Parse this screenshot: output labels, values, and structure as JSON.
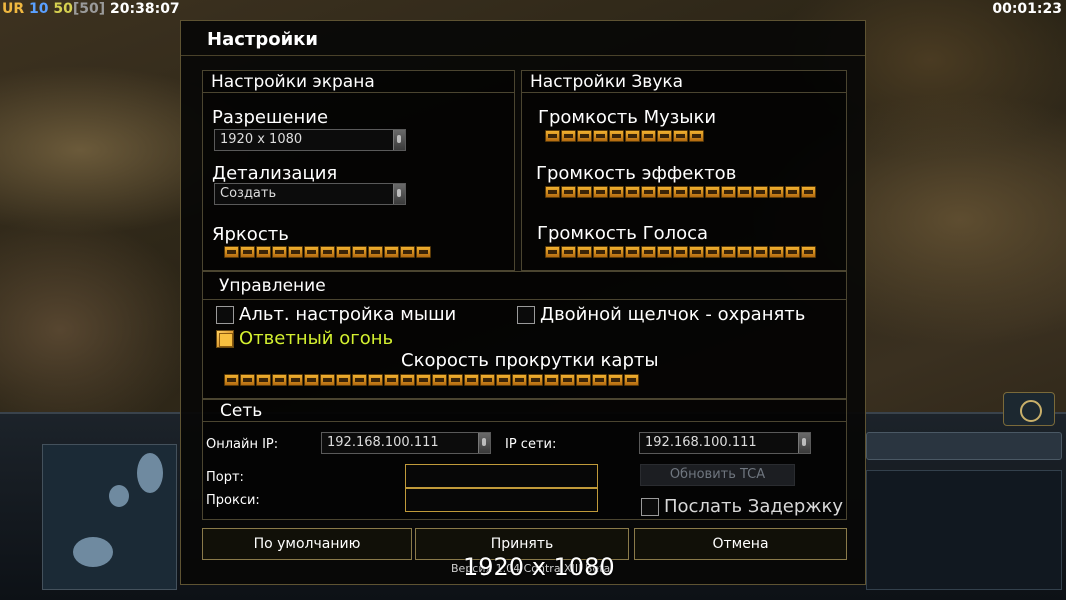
{
  "hud": {
    "ur": "UR",
    "n10": "10",
    "n50": "50",
    "bracket_value": "[50]",
    "clock": "20:38:07",
    "elapsed": "00:01:23"
  },
  "dialog": {
    "title": "Настройки",
    "screen": {
      "header": "Настройки экрана",
      "resolution_label": "Разрешение",
      "resolution_value": "1920 x 1080",
      "detail_label": "Детализация",
      "detail_value": "Создать",
      "brightness_label": "Яркость",
      "brightness_level": 13
    },
    "sound": {
      "header": "Настройки Звука",
      "music_label": "Громкость Музыки",
      "music_level": 10,
      "effects_label": "Громкость эффектов",
      "effects_level": 17,
      "voice_label": "Громкость Голоса",
      "voice_level": 17
    },
    "controls": {
      "header": "Управление",
      "alt_mouse_label": "Альт. настройка мыши",
      "alt_mouse_checked": false,
      "double_click_label": "Двойной щелчок - охранять",
      "double_click_checked": false,
      "return_fire_label": "Ответный огонь",
      "return_fire_checked": true,
      "scroll_speed_label": "Скорость прокрутки карты",
      "scroll_speed_level": 26
    },
    "network": {
      "header": "Сеть",
      "online_ip_label": "Онлайн IP:",
      "online_ip_value": "192.168.100.111",
      "net_ip_label": "IP сети:",
      "net_ip_value": "192.168.100.111",
      "port_label": "Порт:",
      "proxy_label": "Прокси:",
      "update_button": "Обновить TCA",
      "send_delay_label": "Послать Задержку",
      "send_delay_checked": false
    },
    "buttons": {
      "default": "По умолчанию",
      "accept": "Принять",
      "cancel": "Отмена"
    },
    "version_text": "Версия 1.04 Contra XIII Beta",
    "resolution_overlay": "1920 x 1080"
  },
  "colors": {
    "slider": "#e8a020",
    "highlight_text": "#d4f030",
    "border": "#4b4530"
  }
}
